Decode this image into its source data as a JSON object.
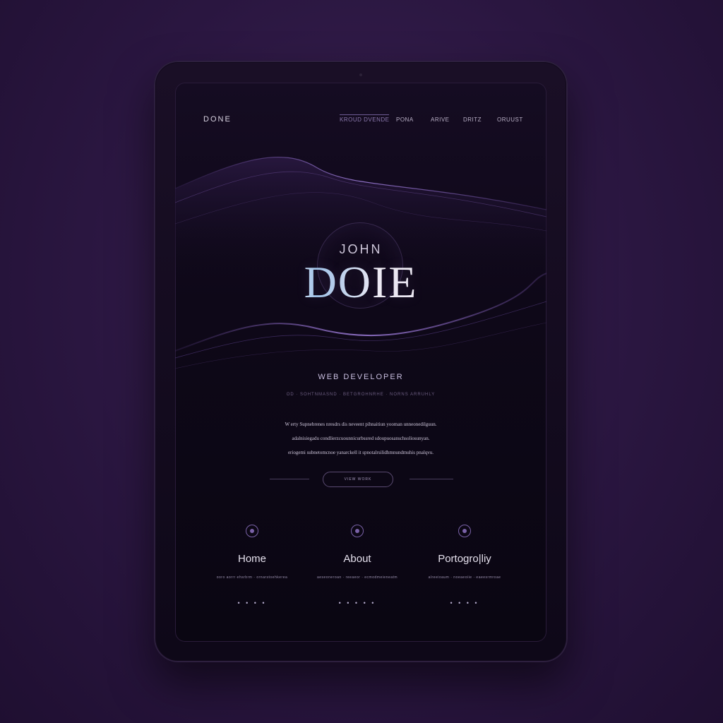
{
  "nav": {
    "brand": "DONE",
    "items": [
      {
        "label": "KROUD DVENDE",
        "active": true
      },
      {
        "label": "PONA",
        "active": false
      },
      {
        "label": "ARIVE",
        "active": false
      },
      {
        "label": "DRITZ",
        "active": false
      },
      {
        "label": "ORUUST",
        "active": false
      }
    ]
  },
  "hero": {
    "first_name": "JOHN",
    "last_name": "DOIE"
  },
  "role": "WEB DEVELOPER",
  "tagline": "OD · SOHTNMASND · BETGROHNRHE · NORNS ARRUHLY",
  "bio": [
    "W erty Supnebrenes nresdrs dis neveent pihnaitiun yooman unneonedilguun.",
    "adalnisiegadu condlierzcuounnicurbssred sdoupuosanschsoliosunyan.",
    "eriogemi subnetomcnoe yanarckell it spnotalrsilidhmnundmuhis pnalqvu."
  ],
  "cta": {
    "label": "VIEW WORK"
  },
  "cards": [
    {
      "icon": "link-icon",
      "title": "Home",
      "desc": "ooro aorrr ehsrbrm · ornarstoehkerea",
      "dots": "• • • •"
    },
    {
      "icon": "target-icon",
      "title": "About",
      "desc": "aeseoneroan · reeaeor · ecmodmeieneatm",
      "dots": "• • • • •"
    },
    {
      "icon": "compass-icon",
      "title": "Portogro|liy",
      "desc": "alreeioaum · noeaeoiie · eaeesrmroae",
      "dots": "• • • •"
    }
  ],
  "colors": {
    "background": "#2a1640",
    "accent": "#7a62a8",
    "screen": "#0e0818"
  }
}
